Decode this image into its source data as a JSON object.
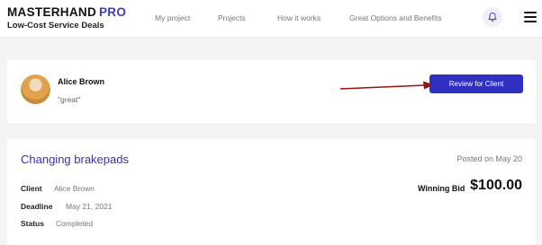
{
  "header": {
    "brand": "MASTERHAND",
    "brand_accent": "PRO",
    "tagline": "Low-Cost Service Deals",
    "nav": [
      {
        "label": "My project"
      },
      {
        "label": "Projects"
      },
      {
        "label": "How it works"
      },
      {
        "label": "Great Options and Benefits"
      }
    ],
    "icons": {
      "notifications": "bell-icon",
      "menu": "hamburger-menu-icon"
    }
  },
  "review": {
    "name": "Alice Brown",
    "text": "\"great\"",
    "button_label": "Review for Client",
    "arrow_color": "#9b1010"
  },
  "job": {
    "title": "Changing brakepads",
    "posted": "Posted on May 20",
    "client_label": "Client",
    "client_value": "Alice Brown",
    "deadline_label": "Deadline",
    "deadline_value": "May 21, 2021",
    "status_label": "Status",
    "status_value": "Completed",
    "bid_label": "Winning Bid",
    "bid_amount": "$100.00"
  },
  "colors": {
    "accent": "#3232b8",
    "button": "#2f2fc0",
    "background": "#f4f4f6"
  }
}
